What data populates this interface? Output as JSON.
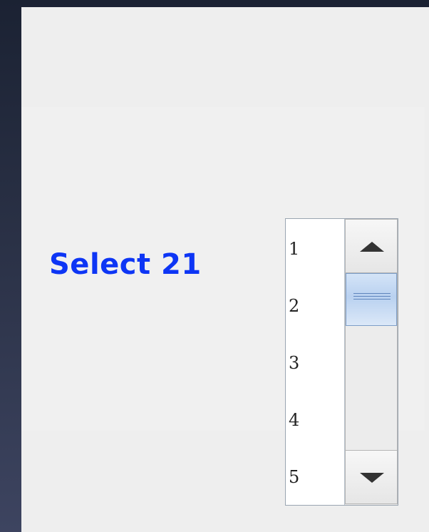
{
  "prompt": {
    "label": "Select 21",
    "color": "#0d35f5"
  },
  "list": {
    "items": [
      "1",
      "2",
      "3",
      "4",
      "5"
    ]
  },
  "scrollbar": {
    "up_icon": "arrow-up-icon",
    "down_icon": "arrow-down-icon",
    "grip_icon": "grip-icon",
    "thumb_position_fraction": 0.0
  }
}
